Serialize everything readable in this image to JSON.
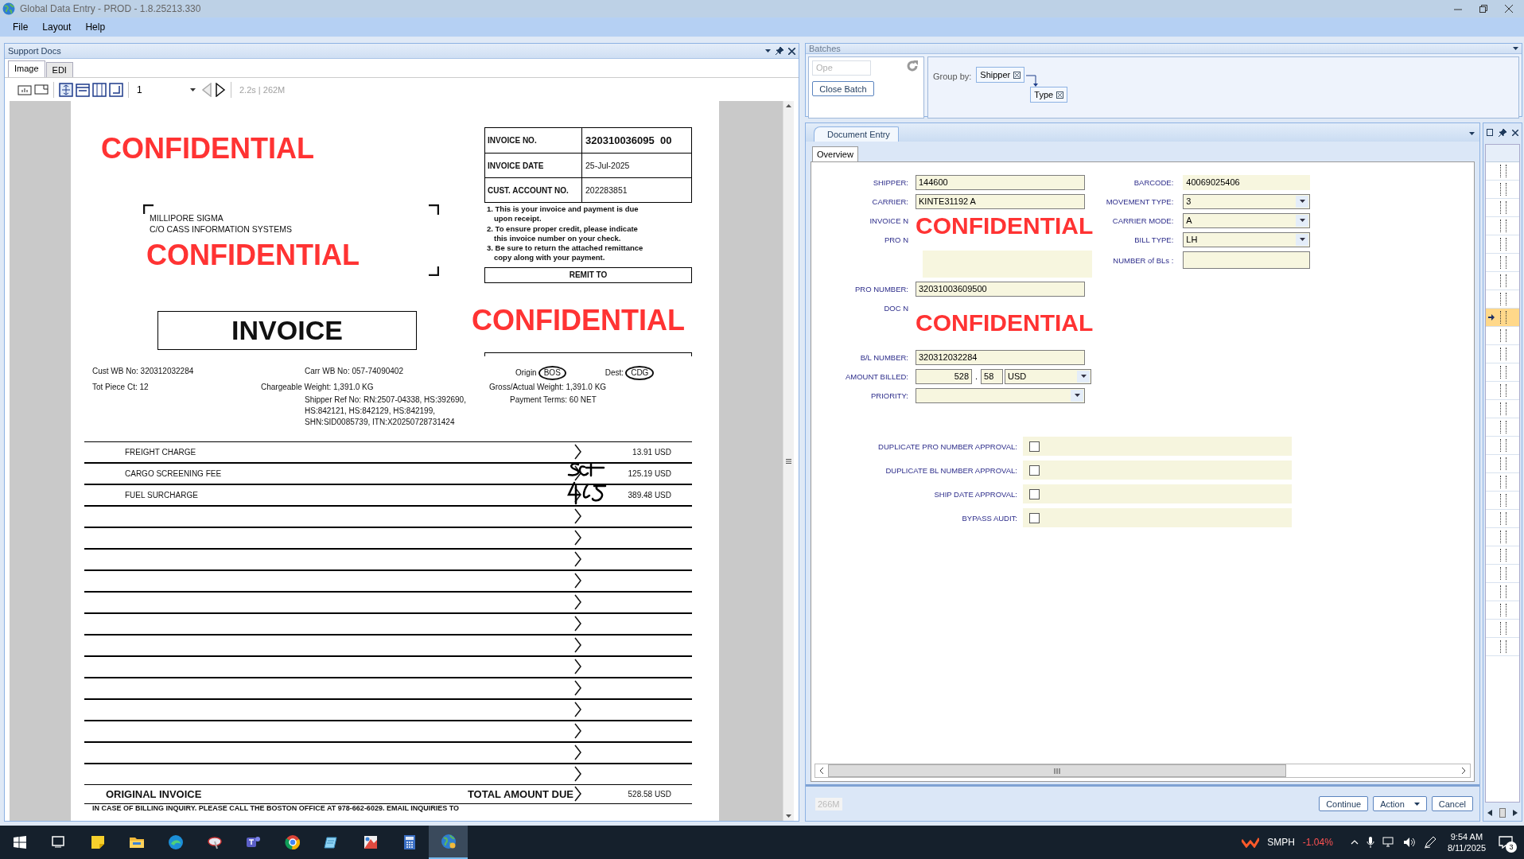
{
  "window": {
    "title": "Global Data Entry - PROD - 1.8.25213.330"
  },
  "menu": [
    "File",
    "Layout",
    "Help"
  ],
  "support_docs": {
    "title": "Support Docs",
    "tabs": [
      {
        "label": "Image",
        "selected": true
      },
      {
        "label": "EDI",
        "selected": false
      }
    ],
    "page": "1",
    "stats": "2.2s | 262M",
    "invoice": {
      "redactions": [
        "CONFIDENTIAL",
        "CONFIDENTIAL",
        "CONFIDENTIAL"
      ],
      "address": [
        "MILLIPORE SIGMA",
        "C/O CASS INFORMATION SYSTEMS"
      ],
      "title": "INVOICE",
      "header_table": [
        {
          "label": "INVOICE NO.",
          "value": "320310036095  00"
        },
        {
          "label": "INVOICE DATE",
          "value": "25-Jul-2025"
        },
        {
          "label": "CUST. ACCOUNT NO.",
          "value": "202283851"
        }
      ],
      "notes": [
        "1. This is your invoice and payment is due upon receipt.",
        "2. To ensure proper credit, please indicate this invoice number on your check.",
        "3. Be sure to return the attached remittance copy along with your payment."
      ],
      "remit_to": "REMIT TO",
      "cust_wb": "Cust WB No: 320312032284",
      "carr_wb": "Carr WB No: 057-74090402",
      "origin_label": "Origin",
      "origin": "BOS",
      "dest_label": "Dest:",
      "dest": "CDG",
      "tot_piece": "Tot Piece Ct: 12",
      "chargeable_weight": "Chargeable Weight: 1,391.0 KG",
      "gross_weight": "Gross/Actual Weight: 1,391.0 KG",
      "shipper_ref": "Shipper Ref No: RN:2507-04338, HS:392690,\nHS:842121, HS:842129, HS:842199,\nSHN:SID0085739, ITN:X20250728731424",
      "payment_terms": "Payment Terms: 60 NET",
      "line_items": [
        {
          "kind": "charge",
          "description": "FREIGHT CHARGE",
          "amount": "13.91 USD"
        },
        {
          "kind": "charge",
          "description": "CARGO SCREENING FEE",
          "amount": "125.19 USD"
        },
        {
          "kind": "charge",
          "description": "FUEL SURCHARGE",
          "amount": "389.48 USD"
        },
        {
          "kind": "blank"
        },
        {
          "kind": "blank"
        },
        {
          "kind": "blank"
        },
        {
          "kind": "blank"
        },
        {
          "kind": "blank"
        },
        {
          "kind": "blank"
        },
        {
          "kind": "blank"
        },
        {
          "kind": "blank"
        },
        {
          "kind": "blank"
        },
        {
          "kind": "blank"
        },
        {
          "kind": "blank"
        },
        {
          "kind": "blank"
        },
        {
          "kind": "blank"
        }
      ],
      "original_label": "ORIGINAL INVOICE",
      "total_label": "TOTAL AMOUNT DUE",
      "total": "528.58 USD",
      "footer": "IN CASE OF BILLING INQUIRY. PLEASE CALL THE BOSTON OFFICE AT 978-662-6029. EMAIL INQUIRIES TO"
    }
  },
  "batches": {
    "title": "Batches",
    "open_field": "Ope",
    "close_button": "Close Batch",
    "group_by_label": "Group by:",
    "groups": [
      "Shipper",
      "Type"
    ]
  },
  "document_entry": {
    "tab": "Document Entry",
    "subtabs": [
      {
        "label": "Overview",
        "selected": true
      }
    ],
    "left_fields": [
      {
        "kind": "text",
        "label": "SHIPPER:",
        "value": "144600"
      },
      {
        "kind": "text",
        "label": "CARRIER:",
        "value": "KINTE31192 A"
      },
      {
        "kind": "redacted",
        "labels": [
          "INVOICE N",
          "PRO N"
        ],
        "text": "CONFIDENTIAL"
      },
      {
        "kind": "blank"
      },
      {
        "kind": "text",
        "label": "PRO NUMBER:",
        "value": "32031003609500"
      },
      {
        "kind": "redacted",
        "labels": [
          "DOC N"
        ],
        "text": "CONFIDENTIAL"
      },
      {
        "kind": "text",
        "label": "B/L NUMBER:",
        "value": "320312032284"
      },
      {
        "kind": "amount",
        "label": "AMOUNT BILLED:",
        "whole": "528",
        "separator": ".",
        "cents": "58",
        "currency": "USD"
      },
      {
        "kind": "dropdown",
        "label": "PRIORITY:"
      }
    ],
    "right_fields": [
      {
        "kind": "readonly",
        "label": "BARCODE:",
        "value": "40069025406"
      },
      {
        "kind": "dropdown",
        "label": "MOVEMENT TYPE:",
        "value": "3"
      },
      {
        "kind": "dropdown",
        "label": "CARRIER MODE:",
        "value": "A"
      },
      {
        "kind": "dropdown",
        "label": "BILL TYPE:",
        "value": "LH"
      },
      {
        "kind": "text",
        "label": "NUMBER of BLs :"
      }
    ],
    "approvals": [
      {
        "label": "DUPLICATE PRO NUMBER APPROVAL:",
        "checked": false
      },
      {
        "label": "DUPLICATE BL NUMBER APPROVAL:",
        "checked": false
      },
      {
        "label": "SHIP DATE APPROVAL:",
        "checked": false
      },
      {
        "label": "BYPASS AUDIT:",
        "checked": false
      }
    ],
    "memory": "266M",
    "buttons": [
      {
        "kind": "plain",
        "label": "Continue"
      },
      {
        "kind": "split",
        "label": "Action"
      },
      {
        "kind": "plain",
        "label": "Cancel"
      }
    ]
  },
  "side_grid": {
    "rows": [
      {
        "selected": false
      },
      {
        "selected": false
      },
      {
        "selected": false
      },
      {
        "selected": false
      },
      {
        "selected": false
      },
      {
        "selected": false
      },
      {
        "selected": false
      },
      {
        "selected": false
      },
      {
        "selected": true
      },
      {
        "selected": false
      },
      {
        "selected": false
      },
      {
        "selected": false
      },
      {
        "selected": false
      },
      {
        "selected": false
      },
      {
        "selected": false
      },
      {
        "selected": false
      },
      {
        "selected": false
      },
      {
        "selected": false
      },
      {
        "selected": false
      },
      {
        "selected": false
      },
      {
        "selected": false
      },
      {
        "selected": false
      },
      {
        "selected": false
      },
      {
        "selected": false
      },
      {
        "selected": false
      },
      {
        "selected": false
      },
      {
        "selected": false
      }
    ]
  },
  "taskbar": {
    "apps": [
      {
        "kind": "task-view",
        "selected": false
      },
      {
        "kind": "sticky-notes",
        "selected": false
      },
      {
        "kind": "folder",
        "selected": false
      },
      {
        "kind": "browser-wave",
        "selected": false
      },
      {
        "kind": "satellite",
        "selected": false
      },
      {
        "kind": "chat",
        "selected": false
      },
      {
        "kind": "browser-ring",
        "selected": false
      },
      {
        "kind": "notepad",
        "selected": false
      },
      {
        "kind": "paint",
        "selected": false
      },
      {
        "kind": "calculator",
        "selected": false
      },
      {
        "kind": "globe",
        "selected": true
      }
    ],
    "ticker": "SMPH",
    "change": "-1.04%",
    "time": "9:54 AM",
    "date": "8/11/2025",
    "notifications": "3"
  }
}
